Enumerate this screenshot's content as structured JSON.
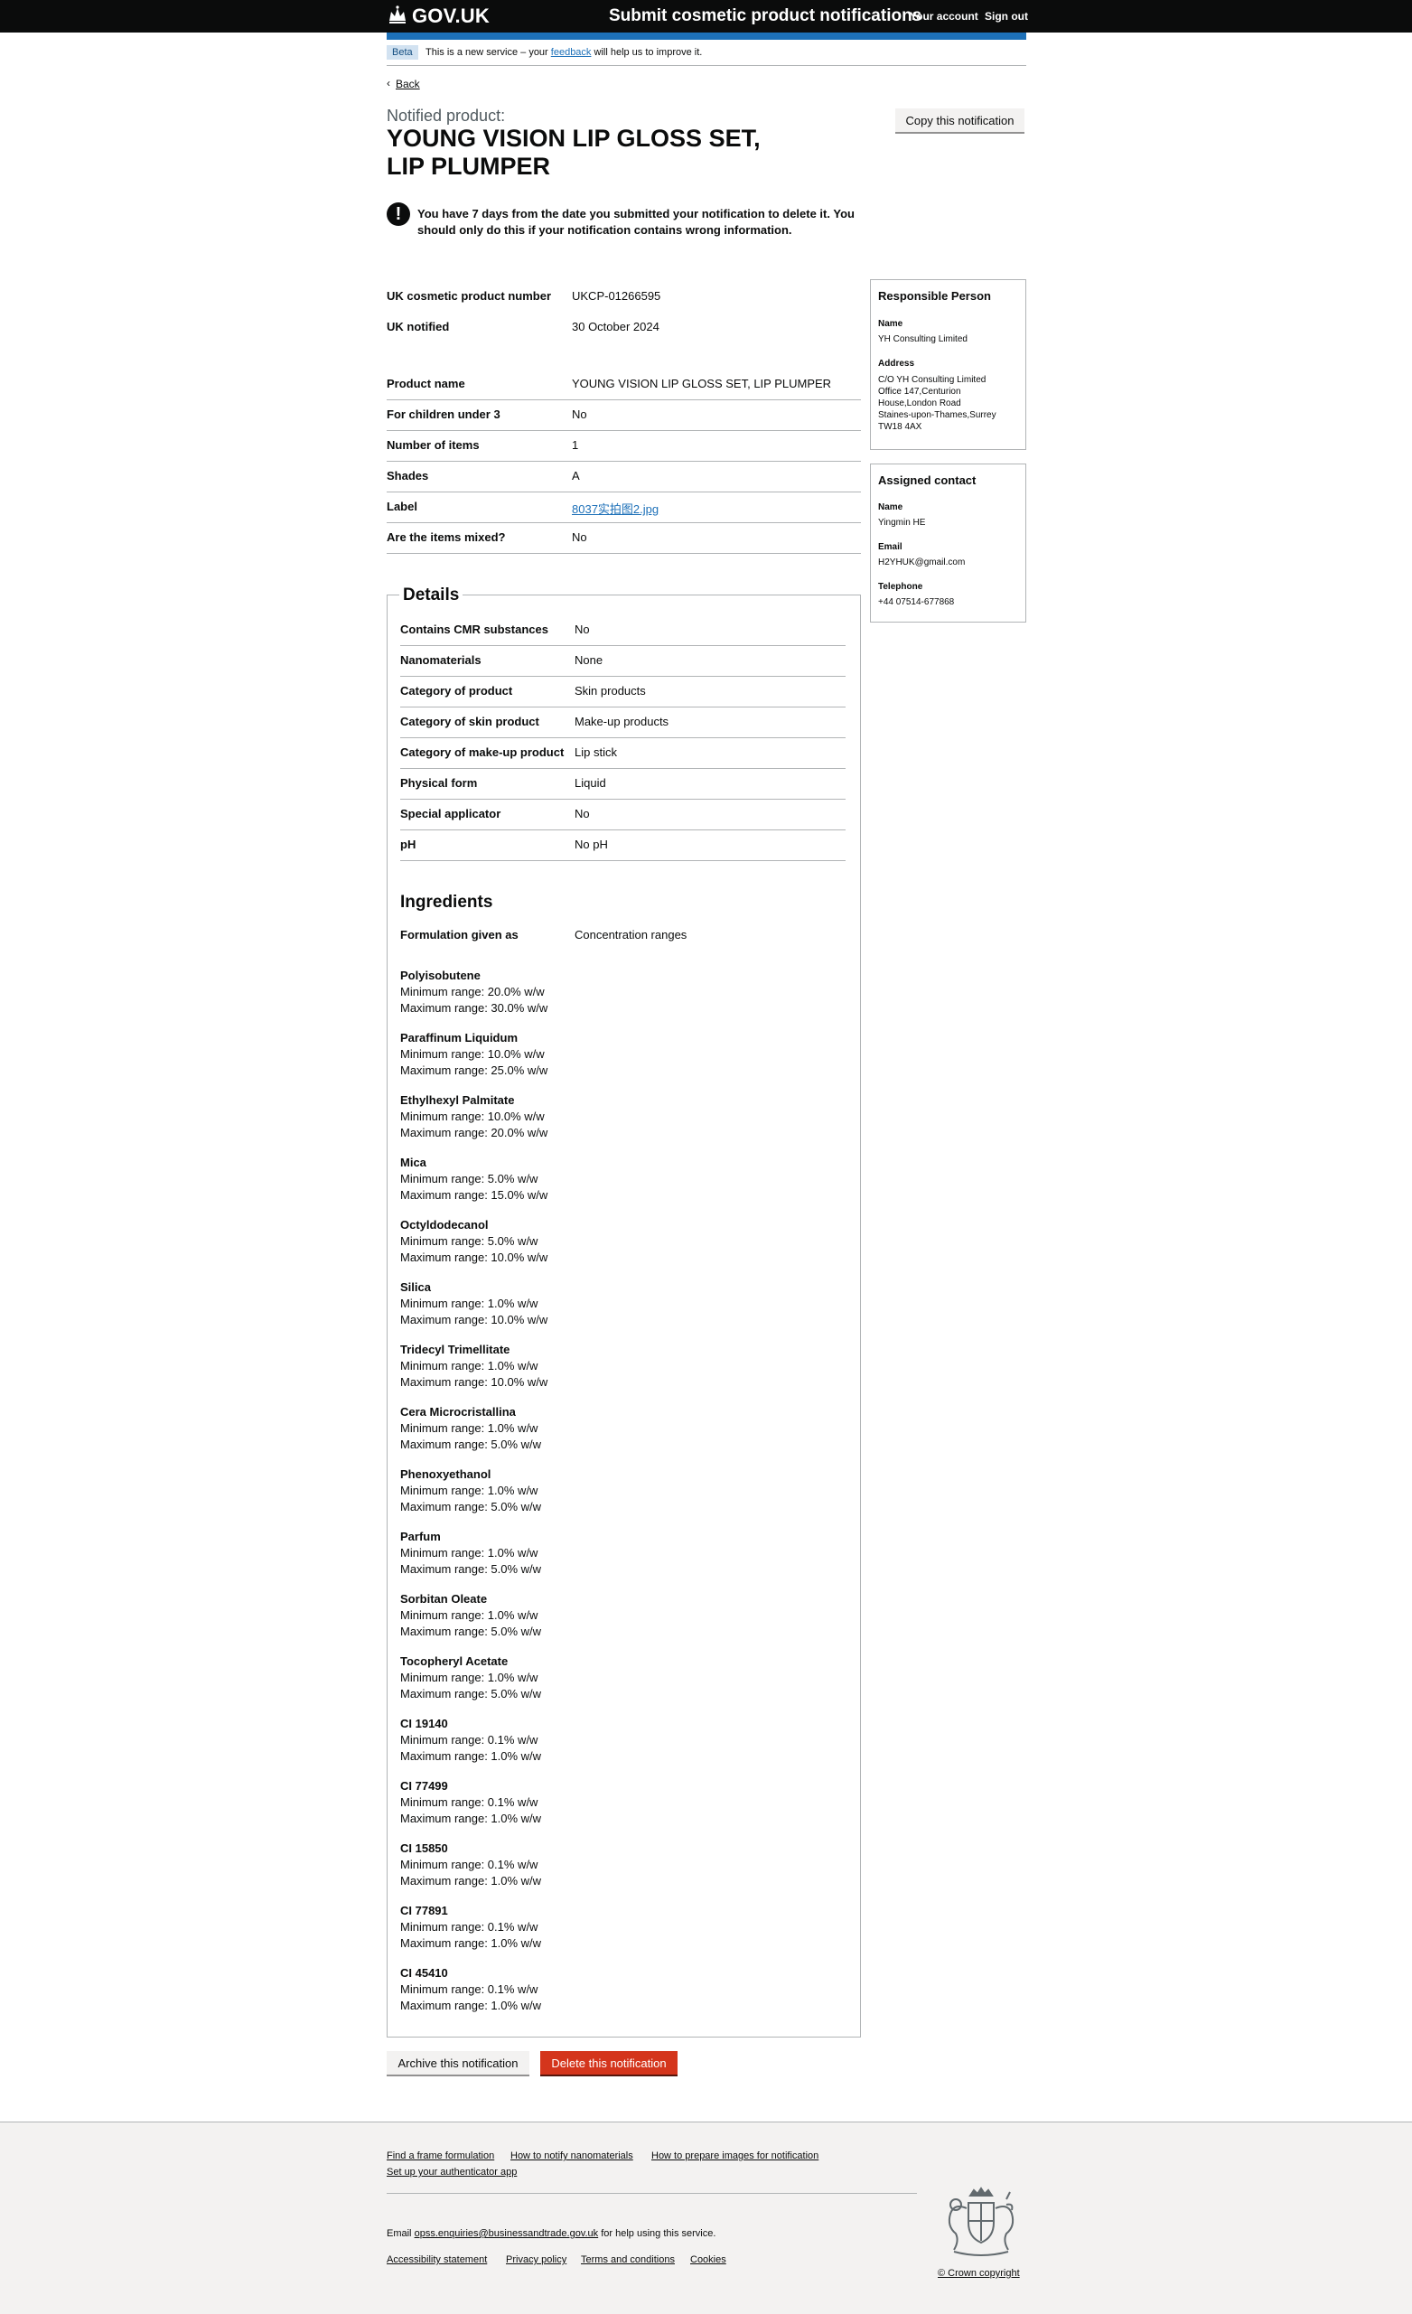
{
  "header": {
    "logo_text": "GOV.UK",
    "service_name": "Submit cosmetic product notifications",
    "your_account": "Your account",
    "sign_out": "Sign out"
  },
  "phase_banner": {
    "tag": "Beta",
    "text_before": "This is a new service – your",
    "feedback_link": "feedback",
    "text_after": "will help us to improve it."
  },
  "back_link": "Back",
  "caption": "Notified product:",
  "title": "YOUNG VISION LIP GLOSS SET, LIP PLUMPER",
  "copy_button": "Copy this notification",
  "warning": {
    "icon": "!",
    "text": "You have 7 days from the date you submitted your notification to delete it. You should only do this if your notification contains wrong information."
  },
  "summary_top": [
    {
      "key": "UK cosmetic product number",
      "value": "UKCP-01266595"
    },
    {
      "key": "UK notified",
      "value": "30 October 2024"
    }
  ],
  "summary_product": [
    {
      "key": "Product name",
      "value": "YOUNG VISION LIP GLOSS SET, LIP PLUMPER"
    },
    {
      "key": "For children under 3",
      "value": "No"
    },
    {
      "key": "Number of items",
      "value": "1"
    },
    {
      "key": "Shades",
      "value": "A"
    },
    {
      "key": "Label",
      "value": "8037实拍图2.jpg",
      "link": true
    },
    {
      "key": "Are the items mixed?",
      "value": "No"
    }
  ],
  "details": {
    "heading": "Details",
    "rows": [
      {
        "key": "Contains CMR substances",
        "value": "No"
      },
      {
        "key": "Nanomaterials",
        "value": "None"
      },
      {
        "key": "Category of product",
        "value": "Skin products"
      },
      {
        "key": "Category of skin product",
        "value": "Make-up products"
      },
      {
        "key": "Category of make-up product",
        "value": "Lip stick"
      },
      {
        "key": "Physical form",
        "value": "Liquid"
      },
      {
        "key": "Special applicator",
        "value": "No"
      },
      {
        "key": "pH",
        "value": "No pH"
      }
    ]
  },
  "ingredients": {
    "heading": "Ingredients",
    "formulation_key": "Formulation given as",
    "formulation_value": "Concentration ranges",
    "items": [
      {
        "name": "Polyisobutene",
        "min": "Minimum range: 20.0% w/w",
        "max": "Maximum range: 30.0% w/w"
      },
      {
        "name": "Paraffinum Liquidum",
        "min": "Minimum range: 10.0% w/w",
        "max": "Maximum range: 25.0% w/w"
      },
      {
        "name": "Ethylhexyl Palmitate",
        "min": "Minimum range: 10.0% w/w",
        "max": "Maximum range: 20.0% w/w"
      },
      {
        "name": "Mica",
        "min": "Minimum range: 5.0% w/w",
        "max": "Maximum range: 15.0% w/w"
      },
      {
        "name": "Octyldodecanol",
        "min": "Minimum range: 5.0% w/w",
        "max": "Maximum range: 10.0% w/w"
      },
      {
        "name": "Silica",
        "min": "Minimum range: 1.0% w/w",
        "max": "Maximum range: 10.0% w/w"
      },
      {
        "name": "Tridecyl Trimellitate",
        "min": "Minimum range: 1.0% w/w",
        "max": "Maximum range: 10.0% w/w"
      },
      {
        "name": "Cera Microcristallina",
        "min": "Minimum range: 1.0% w/w",
        "max": "Maximum range: 5.0% w/w"
      },
      {
        "name": "Phenoxyethanol",
        "min": "Minimum range: 1.0% w/w",
        "max": "Maximum range: 5.0% w/w"
      },
      {
        "name": "Parfum",
        "min": "Minimum range: 1.0% w/w",
        "max": "Maximum range: 5.0% w/w"
      },
      {
        "name": "Sorbitan Oleate",
        "min": "Minimum range: 1.0% w/w",
        "max": "Maximum range: 5.0% w/w"
      },
      {
        "name": "Tocopheryl Acetate",
        "min": "Minimum range: 1.0% w/w",
        "max": "Maximum range: 5.0% w/w"
      },
      {
        "name": "CI 19140",
        "min": "Minimum range: 0.1% w/w",
        "max": "Maximum range: 1.0% w/w"
      },
      {
        "name": "CI 77499",
        "min": "Minimum range: 0.1% w/w",
        "max": "Maximum range: 1.0% w/w"
      },
      {
        "name": "CI 15850",
        "min": "Minimum range: 0.1% w/w",
        "max": "Maximum range: 1.0% w/w"
      },
      {
        "name": "CI 77891",
        "min": "Minimum range: 0.1% w/w",
        "max": "Maximum range: 1.0% w/w"
      },
      {
        "name": "CI 45410",
        "min": "Minimum range: 0.1% w/w",
        "max": "Maximum range: 1.0% w/w"
      }
    ]
  },
  "actions": {
    "archive": "Archive this notification",
    "delete": "Delete this notification"
  },
  "responsible_person": {
    "heading": "Responsible Person",
    "name_label": "Name",
    "name": "YH Consulting Limited",
    "address_label": "Address",
    "address_lines": [
      "C/O YH Consulting Limited",
      "Office 147,Centurion",
      "House,London Road",
      "Staines-upon-Thames,Surrey",
      "TW18 4AX"
    ]
  },
  "assigned_contact": {
    "heading": "Assigned contact",
    "name_label": "Name",
    "name": "Yingmin HE",
    "email_label": "Email",
    "email": "H2YHUK@gmail.com",
    "telephone_label": "Telephone",
    "telephone": "+44 07514-677868"
  },
  "footer": {
    "links_row1": [
      "Find a frame formulation",
      "How to notify nanomaterials",
      "How to prepare images for notification"
    ],
    "links_row2": [
      "Set up your authenticator app"
    ],
    "email_before": "Email",
    "email_link": "opss.enquiries@businessandtrade.gov.uk",
    "email_after": "for help using this service.",
    "meta_links": [
      "Accessibility statement",
      "Privacy policy",
      "Terms and conditions",
      "Cookies"
    ],
    "copyright": "© Crown copyright"
  },
  "colors": {
    "header_bg": "#0b0c0c",
    "brand_blue": "#1d70b8",
    "warning_red": "#d4351c",
    "footer_bg": "#f3f2f1",
    "border_grey": "#b1b4b6"
  },
  "icons": [
    "crown-logo-icon",
    "chevron-left-icon",
    "warning-icon",
    "royal-crest-icon"
  ]
}
